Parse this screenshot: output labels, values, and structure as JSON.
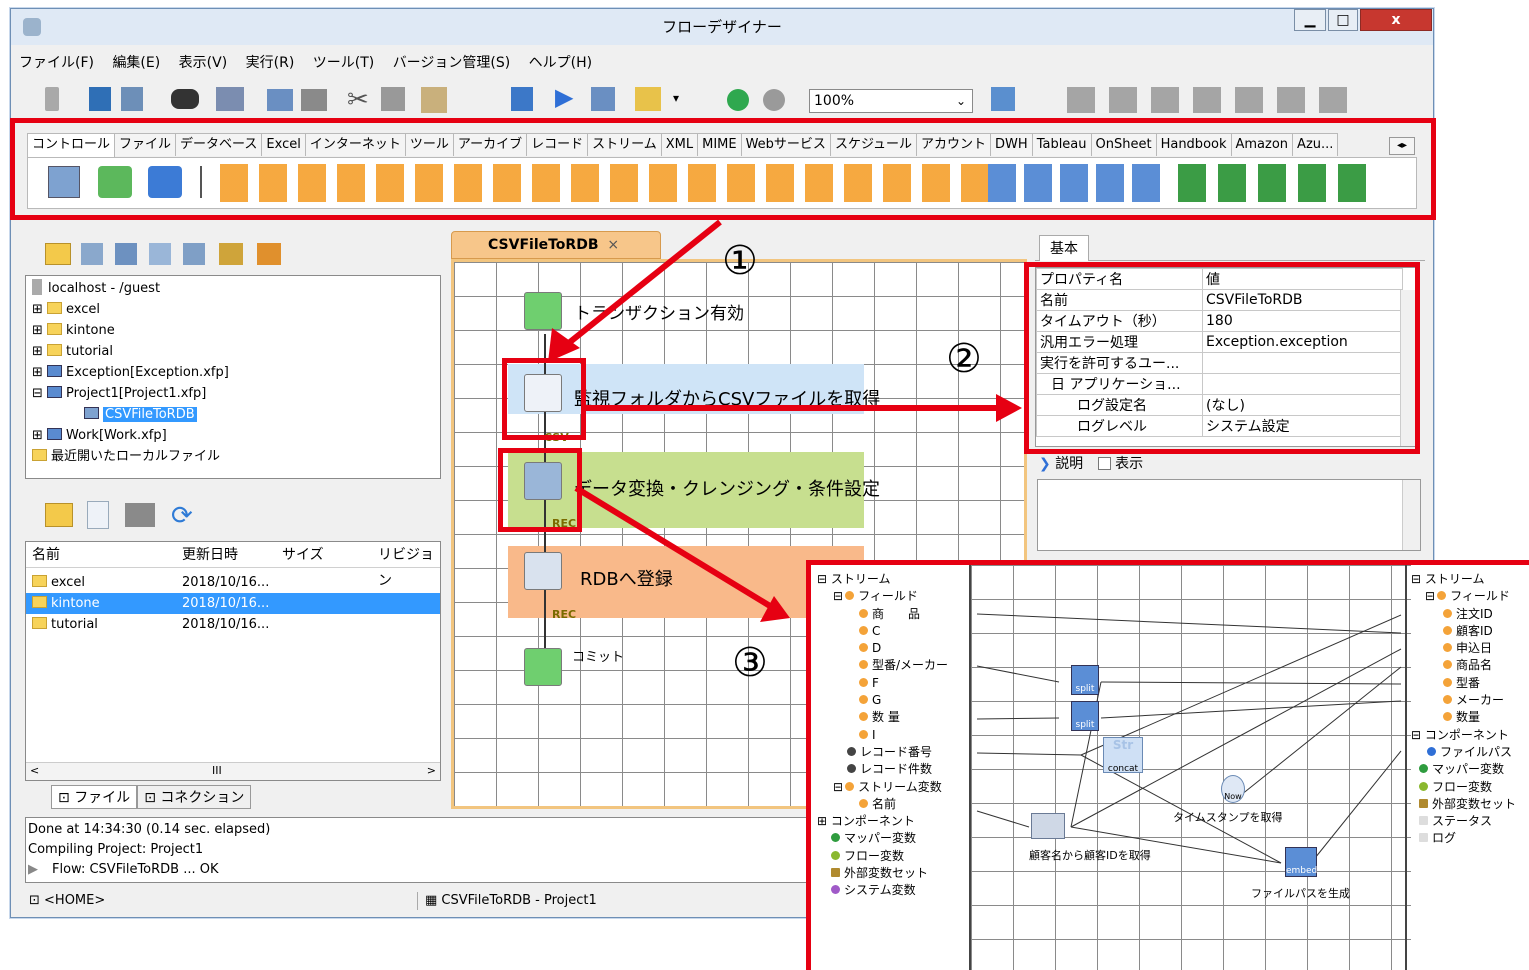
{
  "window": {
    "title": "フローデザイナー"
  },
  "menu": [
    "ファイル(F)",
    "編集(E)",
    "表示(V)",
    "実行(R)",
    "ツール(T)",
    "バージョン管理(S)",
    "ヘルプ(H)"
  ],
  "toolbar": {
    "zoom": "100%"
  },
  "palette_tabs": [
    "コントロール",
    "ファイル",
    "データベース",
    "Excel",
    "インターネット",
    "ツール",
    "アーカイブ",
    "レコード",
    "ストリーム",
    "XML",
    "MIME",
    "Webサービス",
    "スケジュール",
    "アカウント",
    "DWH",
    "Tableau",
    "OnSheet",
    "Handbook",
    "Amazon",
    "Azu..."
  ],
  "tree": {
    "root": "localhost - /guest",
    "items": [
      "excel",
      "kintone",
      "tutorial",
      "Exception[Exception.xfp]",
      "Project1[Project1.xfp]",
      "CSVFileToRDB",
      "Work[Work.xfp]",
      "最近開いたローカルファイル"
    ]
  },
  "files": {
    "columns": [
      "名前",
      "更新日時",
      "サイズ",
      "リビジョン"
    ],
    "rows": [
      {
        "name": "excel",
        "date": "2018/10/16..."
      },
      {
        "name": "kintone",
        "date": "2018/10/16..."
      },
      {
        "name": "tutorial",
        "date": "2018/10/16..."
      }
    ],
    "scroll_mark": "III",
    "tabs": [
      "ファイル",
      "コネクション"
    ]
  },
  "log": [
    "Done at 14:34:30 (0.14 sec. elapsed)",
    "Compiling Project: Project1",
    "Flow: CSVFileToRDB ... OK"
  ],
  "status": {
    "home": "<HOME>",
    "flow": "CSVFileToRDB - Project1"
  },
  "editor": {
    "tab": "CSVFileToRDB",
    "steps": [
      "トランザクション有効",
      "監視フォルダからCSVファイルを取得",
      "データ変換・クレンジング・条件設定",
      "RDBへ登録",
      "コミット"
    ],
    "badges": [
      "CSV",
      "REC",
      "REC"
    ]
  },
  "properties": {
    "tab": "基本",
    "header": [
      "プロパティ名",
      "値"
    ],
    "rows": [
      [
        "名前",
        "CSVFileToRDB"
      ],
      [
        "タイムアウト（秒）",
        "180"
      ],
      [
        "汎用エラー処理",
        "Exception.exception"
      ],
      [
        "実行を許可するユー...",
        ""
      ],
      [
        "日 アプリケーショ...",
        ""
      ],
      [
        "ログ設定名",
        "(なし)"
      ],
      [
        "ログレベル",
        "システム設定"
      ]
    ],
    "desc_label": "説明",
    "show_label": "表示"
  },
  "annotations": [
    "①",
    "②",
    "③"
  ],
  "mapper": {
    "left": [
      "ストリーム",
      "フィールド",
      "商　　品",
      "C",
      "D",
      "型番/メーカー",
      "F",
      "G",
      "数 量",
      "I",
      "レコード番号",
      "レコード件数",
      "ストリーム変数",
      "名前",
      "コンポーネント",
      "マッパー変数",
      "フロー変数",
      "外部変数セット",
      "システム変数"
    ],
    "right": [
      "ストリーム",
      "フィールド",
      "注文ID",
      "顧客ID",
      "申込日",
      "商品名",
      "型番",
      "メーカー",
      "数量",
      "コンポーネント",
      "ファイルパス",
      "マッパー変数",
      "フロー変数",
      "外部変数セット",
      "ステータス",
      "ログ"
    ],
    "functions": [
      "split",
      "split",
      "Str",
      "concat",
      "Now",
      "タイムスタンプを取得",
      "顧客名から顧客IDを取得",
      "embed",
      "ファイルパスを生成"
    ]
  },
  "colors": {
    "annotation": "#e60012",
    "blue_band": "#cfe4f7",
    "green_band": "#c7df8f",
    "orange_band": "#f9b98a",
    "selection": "#3399ff"
  }
}
